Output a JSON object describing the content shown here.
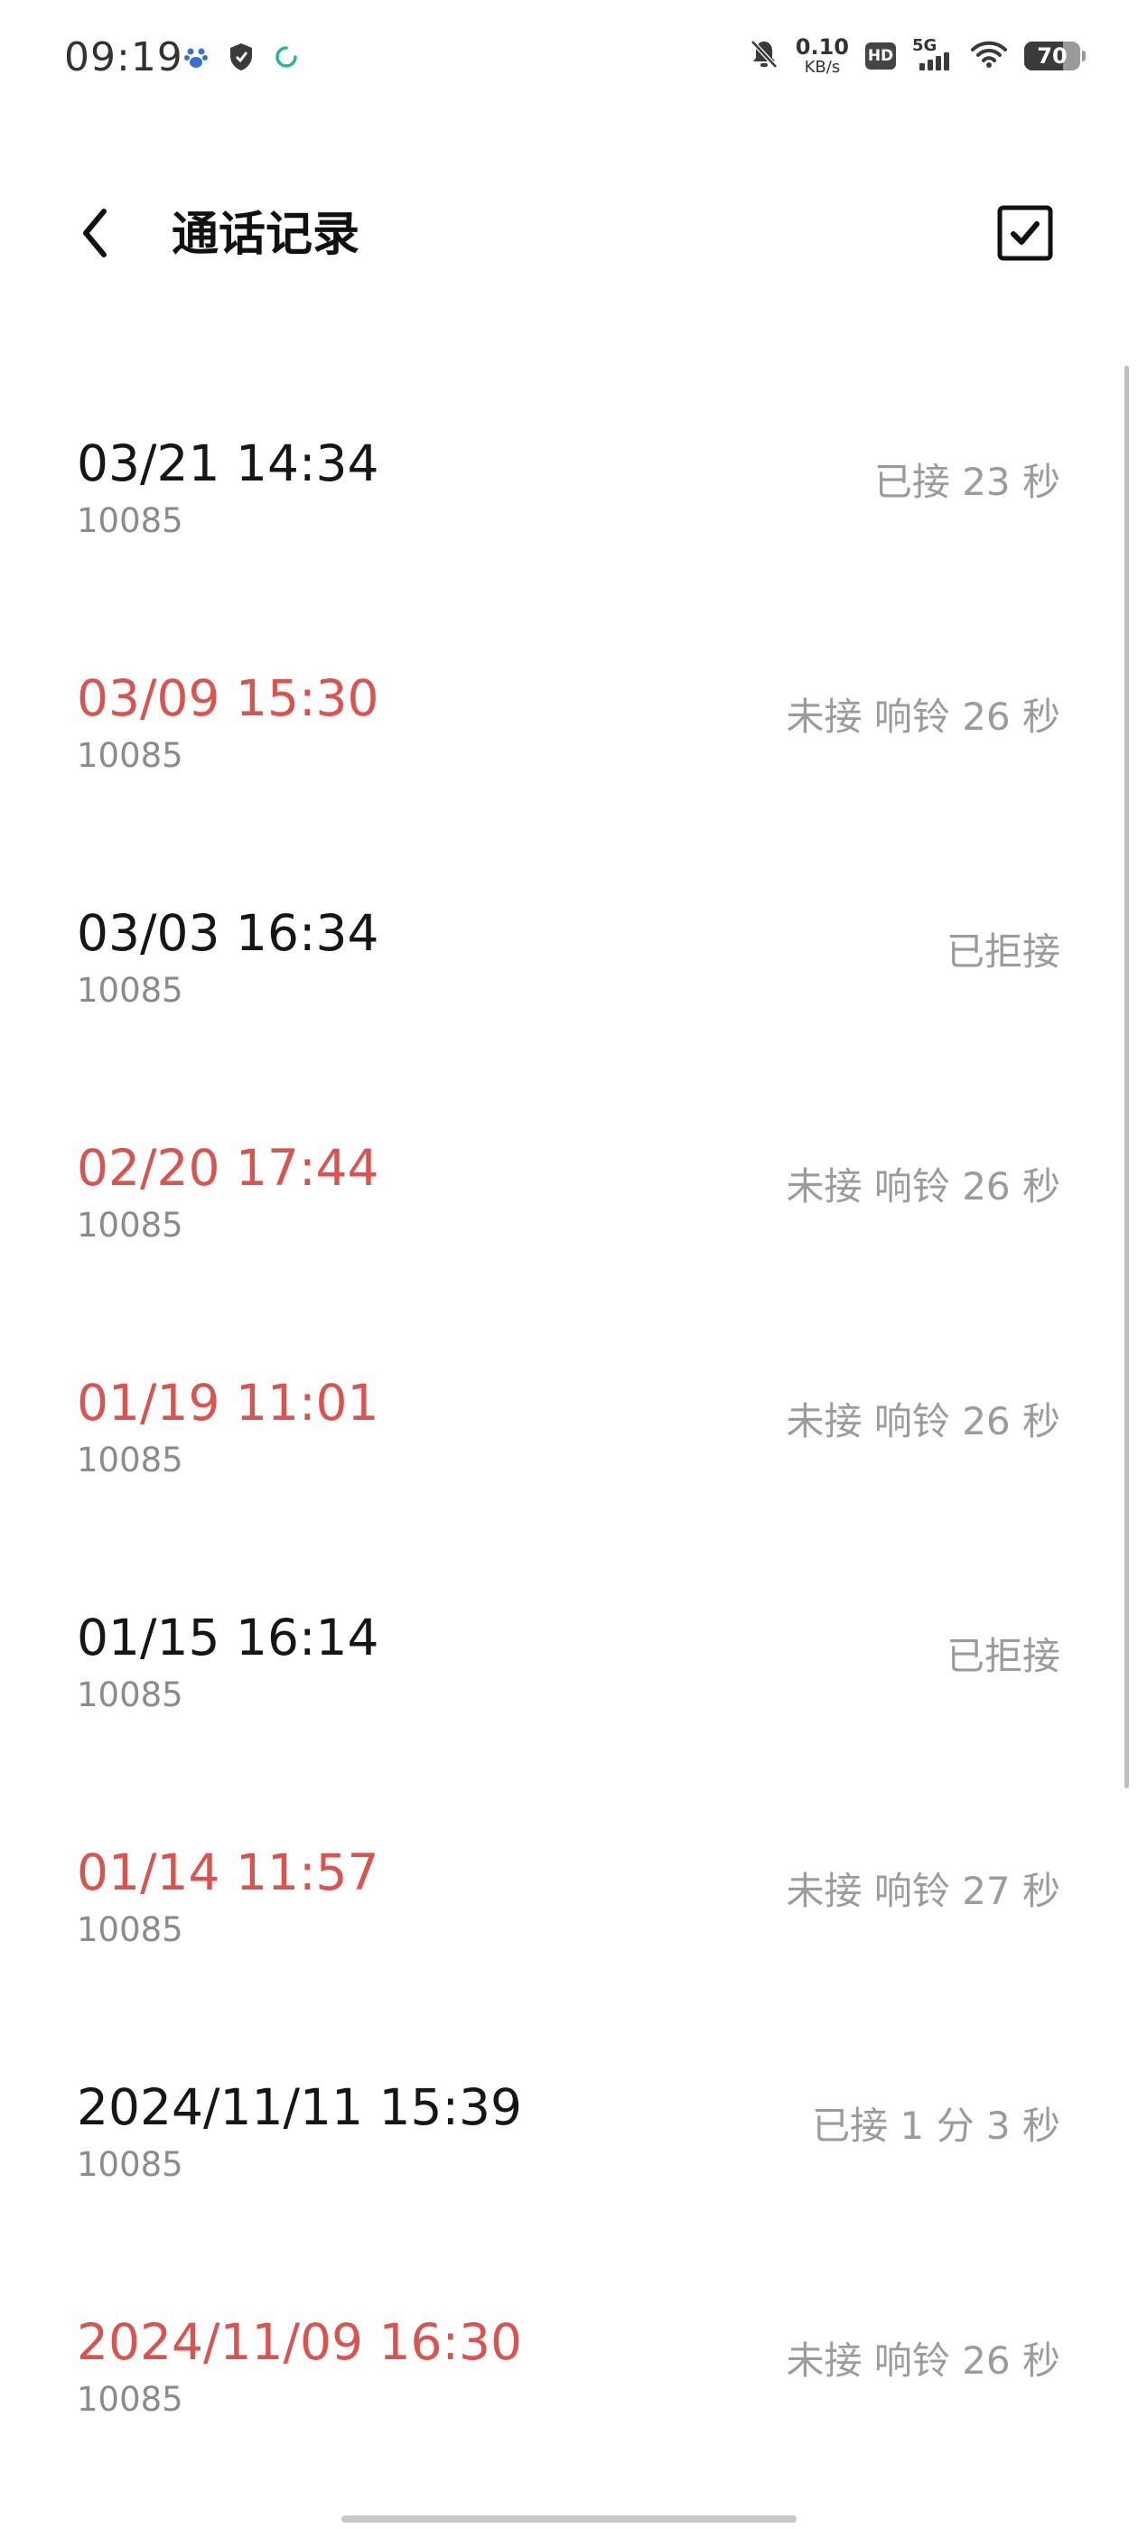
{
  "status_bar": {
    "time": "09:19",
    "left_icons": [
      "baidu-paw-icon",
      "shield-check-icon",
      "sync-ring-icon"
    ],
    "net_speed_value": "0.10",
    "net_speed_unit": "KB/s",
    "hd_label": "HD",
    "network_label": "5G",
    "battery_level": "70",
    "battery_fraction": 0.7,
    "right_icons": [
      "bell-off-icon",
      "hd-icon",
      "signal-5g-icon",
      "wifi-icon",
      "battery-icon"
    ]
  },
  "header": {
    "title": "通话记录",
    "back_icon": "chevron-left-icon",
    "select_icon": "checkbox-checked-icon"
  },
  "colors": {
    "missed": "#d9534f",
    "normal": "#161616",
    "secondary": "#8b8b8b",
    "status": "#9b9b9b"
  },
  "calls": [
    {
      "time": "03/21 14:34",
      "number": "10085",
      "status": "已接 23 秒",
      "missed": false
    },
    {
      "time": "03/09 15:30",
      "number": "10085",
      "status": "未接 响铃 26 秒",
      "missed": true
    },
    {
      "time": "03/03 16:34",
      "number": "10085",
      "status": "已拒接",
      "missed": false
    },
    {
      "time": "02/20 17:44",
      "number": "10085",
      "status": "未接 响铃 26 秒",
      "missed": true
    },
    {
      "time": "01/19 11:01",
      "number": "10085",
      "status": "未接 响铃 26 秒",
      "missed": true
    },
    {
      "time": "01/15 16:14",
      "number": "10085",
      "status": "已拒接",
      "missed": false
    },
    {
      "time": "01/14 11:57",
      "number": "10085",
      "status": "未接 响铃 27 秒",
      "missed": true
    },
    {
      "time": "2024/11/11 15:39",
      "number": "10085",
      "status": "已接 1 分 3 秒",
      "missed": false
    },
    {
      "time": "2024/11/09 16:30",
      "number": "10085",
      "status": "未接 响铃 26 秒",
      "missed": true
    }
  ]
}
